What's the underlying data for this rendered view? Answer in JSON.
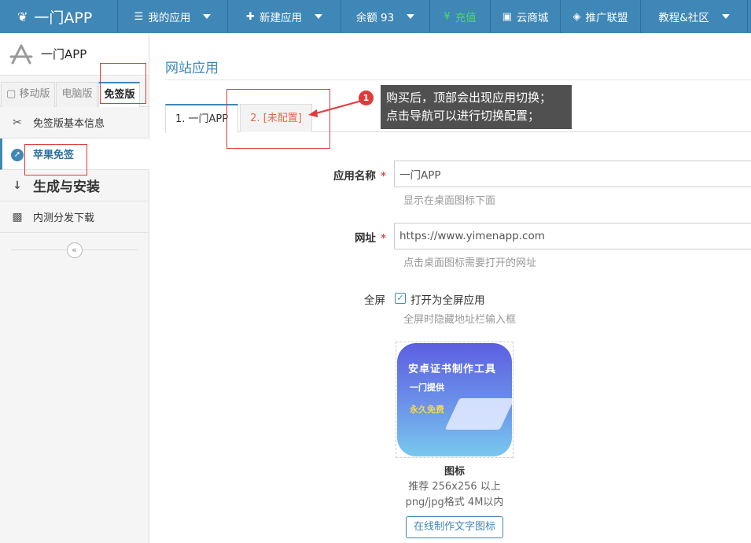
{
  "nav": {
    "brand": "一门APP",
    "items": [
      {
        "icon": "list-icon",
        "label": "我的应用",
        "dropdown": true
      },
      {
        "icon": "plus-icon",
        "label": "新建应用",
        "dropdown": true
      },
      {
        "label": "余额 93",
        "dropdown": true
      },
      {
        "icon": "yuan-icon",
        "label": "充值"
      },
      {
        "icon": "shop-icon",
        "label": "云商城"
      },
      {
        "icon": "diamond-icon",
        "label": "推广联盟"
      },
      {
        "label": "教程&社区",
        "dropdown": true
      }
    ]
  },
  "sidebar": {
    "title": "一门APP",
    "tabs": [
      "移动版",
      "电脑版",
      "免签版"
    ],
    "active_tab": "免签版",
    "items": [
      {
        "icon": "scissors-icon",
        "label": "免签版基本信息"
      },
      {
        "icon": "compass-icon",
        "label": "苹果免签",
        "active": true
      },
      {
        "icon": "sort-icon",
        "label": "生成与安装"
      },
      {
        "icon": "qrcode-icon",
        "label": "内测分发下载"
      }
    ],
    "collapse_label": "«"
  },
  "main": {
    "title": "网站应用",
    "tabs": [
      "1. 一门APP",
      "2. [未配置]"
    ],
    "form": {
      "name_label": "应用名称",
      "name_value": "一门APP",
      "name_help": "显示在桌面图标下面",
      "url_label": "网址",
      "url_value": "https://www.yimenapp.com",
      "url_help": "点击桌面图标需要打开的网址",
      "fullscreen_label": "全屏",
      "fullscreen_checkbox": "打开为全屏应用",
      "fullscreen_checked": true,
      "fullscreen_help": "全屏时隐藏地址栏输入框",
      "icon_title": "图标",
      "icon_hint1": "推荐 256x256 以上",
      "icon_hint2": "png/jpg格式 4M以内",
      "icon_button": "在线制作文字图标",
      "icon_image_text": [
        "安卓证书制作工具",
        "一门提供",
        "永久免费"
      ]
    }
  },
  "annotation": {
    "badge": "1",
    "line1": "购买后，顶部会出现应用切换；",
    "line2": "点击导航可以进行切换配置；"
  },
  "colors": {
    "brand": "#3f87b6",
    "recharge": "#4cd964",
    "warn": "#e46b4a",
    "annotation": "#e03a3a"
  }
}
